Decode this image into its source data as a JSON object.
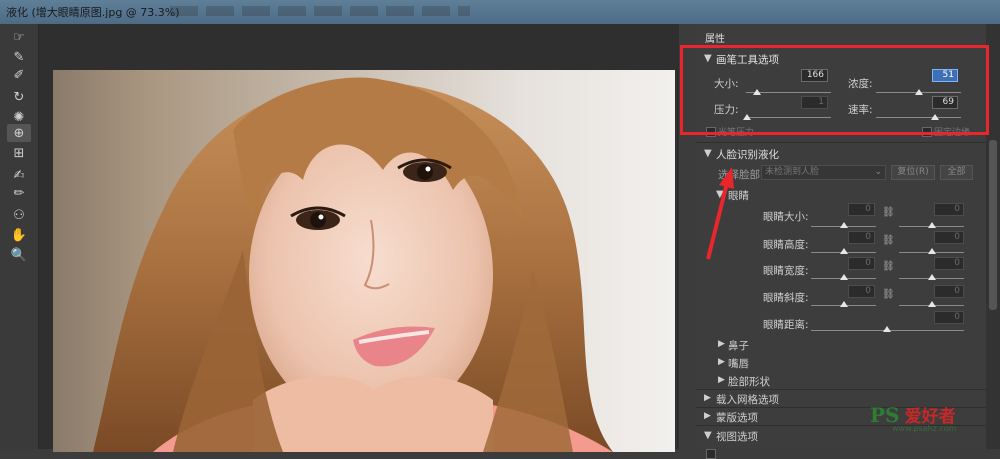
{
  "window": {
    "title": "液化 (增大眼睛原图.jpg @ 73.3%)"
  },
  "tools": [
    {
      "icon": "forward-warp-icon",
      "glyph": "☞"
    },
    {
      "icon": "reconstruct-icon",
      "glyph": "✎"
    },
    {
      "icon": "smooth-icon",
      "glyph": "✐"
    },
    {
      "icon": "twirl-icon",
      "glyph": "↻"
    },
    {
      "icon": "pucker-icon",
      "glyph": "✺"
    },
    {
      "icon": "bloat-icon",
      "glyph": "⊕"
    },
    {
      "icon": "push-left-icon",
      "glyph": "⊞"
    },
    {
      "icon": "freeze-mask-icon",
      "glyph": "✍"
    },
    {
      "icon": "thaw-mask-icon",
      "glyph": "✏"
    },
    {
      "icon": "face-tool-icon",
      "glyph": "⚇"
    },
    {
      "icon": "hand-icon",
      "glyph": "✋"
    },
    {
      "icon": "zoom-icon",
      "glyph": "🔍"
    }
  ],
  "panel": {
    "title": "属性",
    "brush": {
      "header": "画笔工具选项",
      "size_label": "大小:",
      "size_value": "166",
      "size_level": 0.13,
      "density_label": "浓度:",
      "density_value": "51",
      "density_level": 0.51,
      "pressure_label": "压力:",
      "pressure_value": "1",
      "pressure_level": 0.01,
      "rate_label": "速率:",
      "rate_value": "69",
      "rate_level": 0.69,
      "opt1": "光笔压力",
      "opt2": "固定边缘"
    },
    "face": {
      "header": "人脸识别液化",
      "select_label": "选择脸部:",
      "select_value": "未检测到人脸",
      "reset": "复位(R)",
      "all": "全部",
      "eyes_header": "眼睛",
      "rows": [
        {
          "label": "眼睛大小:",
          "left": "0",
          "right": "0"
        },
        {
          "label": "眼睛高度:",
          "left": "0",
          "right": "0"
        },
        {
          "label": "眼睛宽度:",
          "left": "0",
          "right": "0"
        },
        {
          "label": "眼睛斜度:",
          "left": "0",
          "right": "0"
        }
      ],
      "distance_label": "眼睛距离:",
      "distance_value": "0",
      "nose": "鼻子",
      "mouth": "嘴唇",
      "shape": "脸部形状"
    },
    "sections": [
      "载入网格选项",
      "蒙版选项",
      "视图选项"
    ]
  },
  "watermark": {
    "ps": "PS",
    "name": "爱好者",
    "url": "www.psahz.com"
  }
}
